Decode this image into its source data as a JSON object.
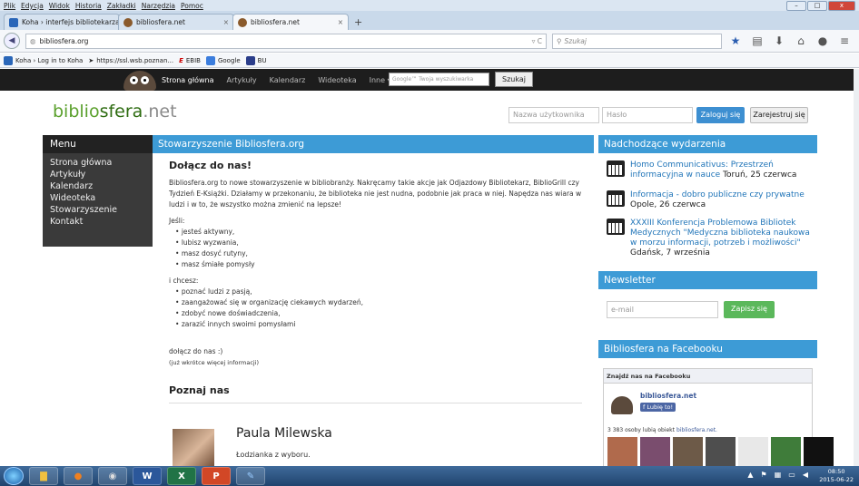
{
  "menubar": {
    "items": [
      "Plik",
      "Edycja",
      "Widok",
      "Historia",
      "Zakładki",
      "Narzędzia",
      "Pomoc"
    ]
  },
  "tabs": [
    {
      "label": "Koha › interfejs bibliotekarza",
      "active": false
    },
    {
      "label": "bibliosfera.net",
      "active": false
    },
    {
      "label": "bibliosfera.net",
      "active": true
    }
  ],
  "nav": {
    "url": "bibliosfera.org",
    "search_placeholder": "Szukaj"
  },
  "bookmarks": [
    {
      "label": "Koha › Log in to Koha"
    },
    {
      "label": "https://ssl.wsb.poznan..."
    },
    {
      "label": "EBIB"
    },
    {
      "label": "Google"
    },
    {
      "label": "BU"
    }
  ],
  "site": {
    "nav_links": [
      "Strona główna",
      "Artykuły",
      "Kalendarz",
      "Wideoteka",
      "Inne ▾"
    ],
    "google_placeholder": "Google™ Twoja wyszukiwarka",
    "search_button": "Szukaj",
    "logo": {
      "a": "biblio",
      "b": "sfera",
      "c": ".net"
    },
    "login": {
      "user_placeholder": "Nazwa użytkownika",
      "pass_placeholder": "Hasło",
      "login_button": "Zaloguj się",
      "register_button": "Zarejestruj się"
    },
    "menu": {
      "title": "Menu",
      "items": [
        "Strona główna",
        "Artykuły",
        "Kalendarz",
        "Wideoteka",
        "Stowarzyszenie",
        "Kontakt"
      ]
    },
    "main_header": "Stowarzyszenie Bibliosfera.org",
    "main": {
      "title": "Dołącz do nas!",
      "intro": "Bibliosfera.org to nowe stowarzyszenie w bibliobranży. Nakręcamy takie akcje jak Odjazdowy Bibliotekarz, BiblioGrill czy Tydzień E-Książki. Działamy w przekonaniu, że biblioteka nie jest nudna, podobnie jak praca w niej. Napędza nas wiara w ludzi i w to, że wszystko można zmienić na lepsze!",
      "if_label": "Jeśli:",
      "if_items": [
        "jesteś aktywny,",
        "lubisz wyzwania,",
        "masz dosyć rutyny,",
        "masz śmiałe pomysły"
      ],
      "want_label": "i chcesz:",
      "want_items": [
        "poznać ludzi z pasją,",
        "zaangażować się w organizację ciekawych wydarzeń,",
        "zdobyć nowe doświadczenia,",
        "zarazić innych swoimi pomysłami"
      ],
      "join": "dołącz do nas :)",
      "more": "(już wkrótce więcej informacji)",
      "meet_title": "Poznaj nas",
      "person_name": "Paula Milewska",
      "person_desc": "Łodzianka z wyboru."
    },
    "events_header": "Nadchodzące wydarzenia",
    "events": [
      {
        "title": "Homo Communicativus: Przestrzeń informacyjna w nauce",
        "place": " Toruń, 25 czerwca"
      },
      {
        "title": "Informacja - dobro publiczne czy prywatne",
        "place": " Opole, 26 czerwca"
      },
      {
        "title": "XXXIII Konferencja Problemowa Bibliotek Medycznych \"Medyczna biblioteka naukowa w morzu informacji, potrzeb i możliwości\"",
        "place": " Gdańsk, 7 września"
      }
    ],
    "newsletter_header": "Newsletter",
    "newsletter": {
      "email_placeholder": "e-mail",
      "button": "Zapisz się"
    },
    "facebook_header": "Bibliosfera na Facebooku",
    "facebook": {
      "box_title": "Znajdź nas na Facebooku",
      "page_name": "bibliosfera.net",
      "like_button": "Lubię to!",
      "count_text": "3 383 osoby lubią obiekt",
      "count_link": "bibliosfera.net."
    }
  },
  "taskbar": {
    "time": "08:50",
    "date": "2015-06-22"
  }
}
